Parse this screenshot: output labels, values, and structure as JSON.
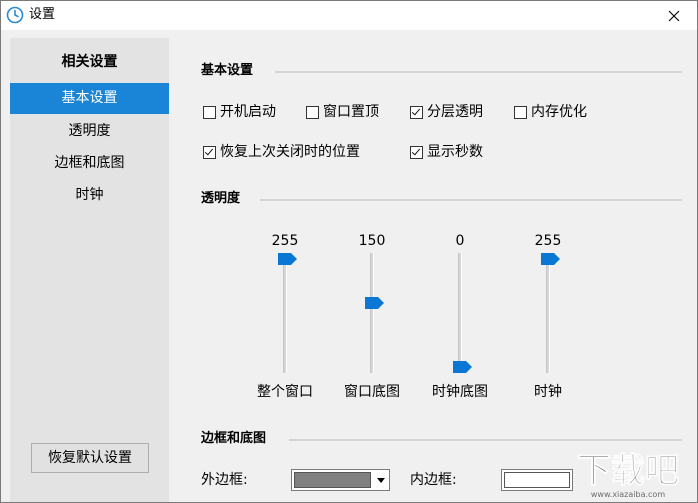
{
  "window": {
    "title": "设置"
  },
  "sidebar": {
    "heading": "相关设置",
    "items": [
      {
        "label": "基本设置",
        "active": true
      },
      {
        "label": "透明度",
        "active": false
      },
      {
        "label": "边框和底图",
        "active": false
      },
      {
        "label": "时钟",
        "active": false
      }
    ],
    "restore_button": "恢复默认设置"
  },
  "basic": {
    "title": "基本设置",
    "options": [
      {
        "label": "开机启动",
        "checked": false
      },
      {
        "label": "窗口置顶",
        "checked": false
      },
      {
        "label": "分层透明",
        "checked": true
      },
      {
        "label": "内存优化",
        "checked": false
      },
      {
        "label": "恢复上次关闭时的位置",
        "checked": true
      },
      {
        "label": "显示秒数",
        "checked": true
      }
    ]
  },
  "transparency": {
    "title": "透明度",
    "sliders": [
      {
        "label": "整个窗口",
        "value": "255",
        "level": 1.0
      },
      {
        "label": "窗口底图",
        "value": "150",
        "level": 0.588
      },
      {
        "label": "时钟底图",
        "value": "0",
        "level": 0.0
      },
      {
        "label": "时钟",
        "value": "255",
        "level": 1.0
      }
    ]
  },
  "border": {
    "title": "边框和底图",
    "outer_label": "外边框:",
    "outer_color": "#808080",
    "inner_label": "内边框:",
    "inner_color": "#ffffff"
  },
  "colors": {
    "accent": "#1a84d6",
    "thumb": "#0a77d5"
  },
  "watermark": {
    "text": "下载吧",
    "site": "www.xiazaiba.com"
  }
}
